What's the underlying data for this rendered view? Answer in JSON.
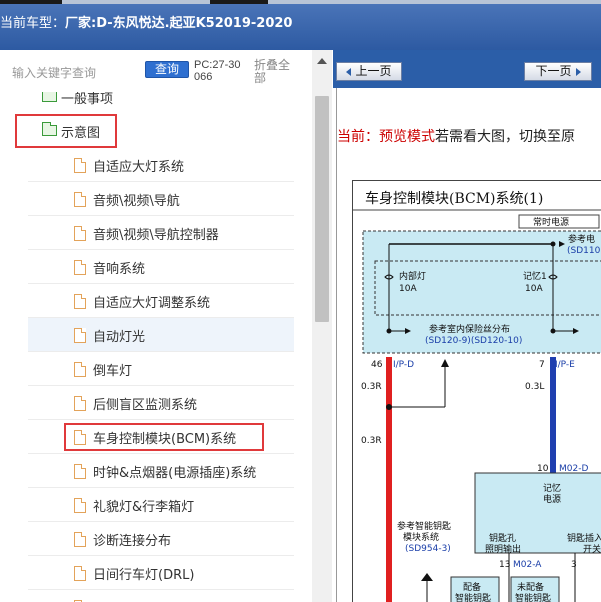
{
  "header": {
    "car_label": "当前车型：",
    "car_value": "厂家:D-东风悦达.起亚K52019-2020"
  },
  "search": {
    "placeholder": "输入关键字查询",
    "query_label": "查询",
    "pc_code": "PC:27-30066",
    "collapse_label": "折叠全部"
  },
  "tree": {
    "top_partial": "一般事项",
    "folder": "示意图",
    "items": [
      "自适应大灯系统",
      "音频\\视频\\导航",
      "音频\\视频\\导航控制器",
      "音响系统",
      "自适应大灯调整系统",
      "自动灯光",
      "倒车灯",
      "后侧盲区监测系统",
      "车身控制模块(BCM)系统",
      "时钟&点烟器(电源插座)系统",
      "礼貌灯&行李箱灯",
      "诊断连接分布",
      "日间行车灯(DRL)"
    ]
  },
  "nav": {
    "prev": "上一页",
    "next": "下一页"
  },
  "preview": {
    "prefix": "当前：",
    "mode": "预览模式",
    "rest": "若需看大图，切换至原"
  },
  "diagram": {
    "title": "车身控制模块(BCM)系统(1)",
    "always_power": "常时电源",
    "ref_power": "参考电",
    "ref_power_code": "(SD110",
    "interior_lamp": "内部灯",
    "interior_amp": "10A",
    "memory1": "记忆1",
    "memory_amp": "10A",
    "fuse_ref": "参考室内保险丝分布",
    "fuse_codes": "(SD120-9)(SD120-10)",
    "pin46": "46",
    "ipd": "I/P-D",
    "pin7": "7",
    "ipe": "I/P-E",
    "w1": "0.3R",
    "w2": "0.3L",
    "w3": "0.3R",
    "pin10": "10",
    "m02d": "M02-D",
    "memory_power": "记忆",
    "memory_power2": "电源",
    "ref_smartkey": "参考智能钥匙",
    "ref_smartkey2": "模块系统",
    "smartkey_code": "(SD954-3)",
    "keyhole": "钥匙孔",
    "keyhole2": "照明输出",
    "key_insert": "钥匙插入",
    "key_insert2": "开关",
    "n13": "13",
    "m02a": "M02-A",
    "n3": "3",
    "equip": "配备",
    "equip2": "智能钥匙",
    "not_equip": "未配备",
    "not_equip2": "智能钥匙"
  },
  "colors": {
    "header_bg": "#2d5aa2",
    "query_btn": "#2e6fd0",
    "highlight_box": "#e0393b",
    "wire_red": "#e02020",
    "wire_blue": "#1f3fb0",
    "module_fill": "#c9eaf3"
  }
}
